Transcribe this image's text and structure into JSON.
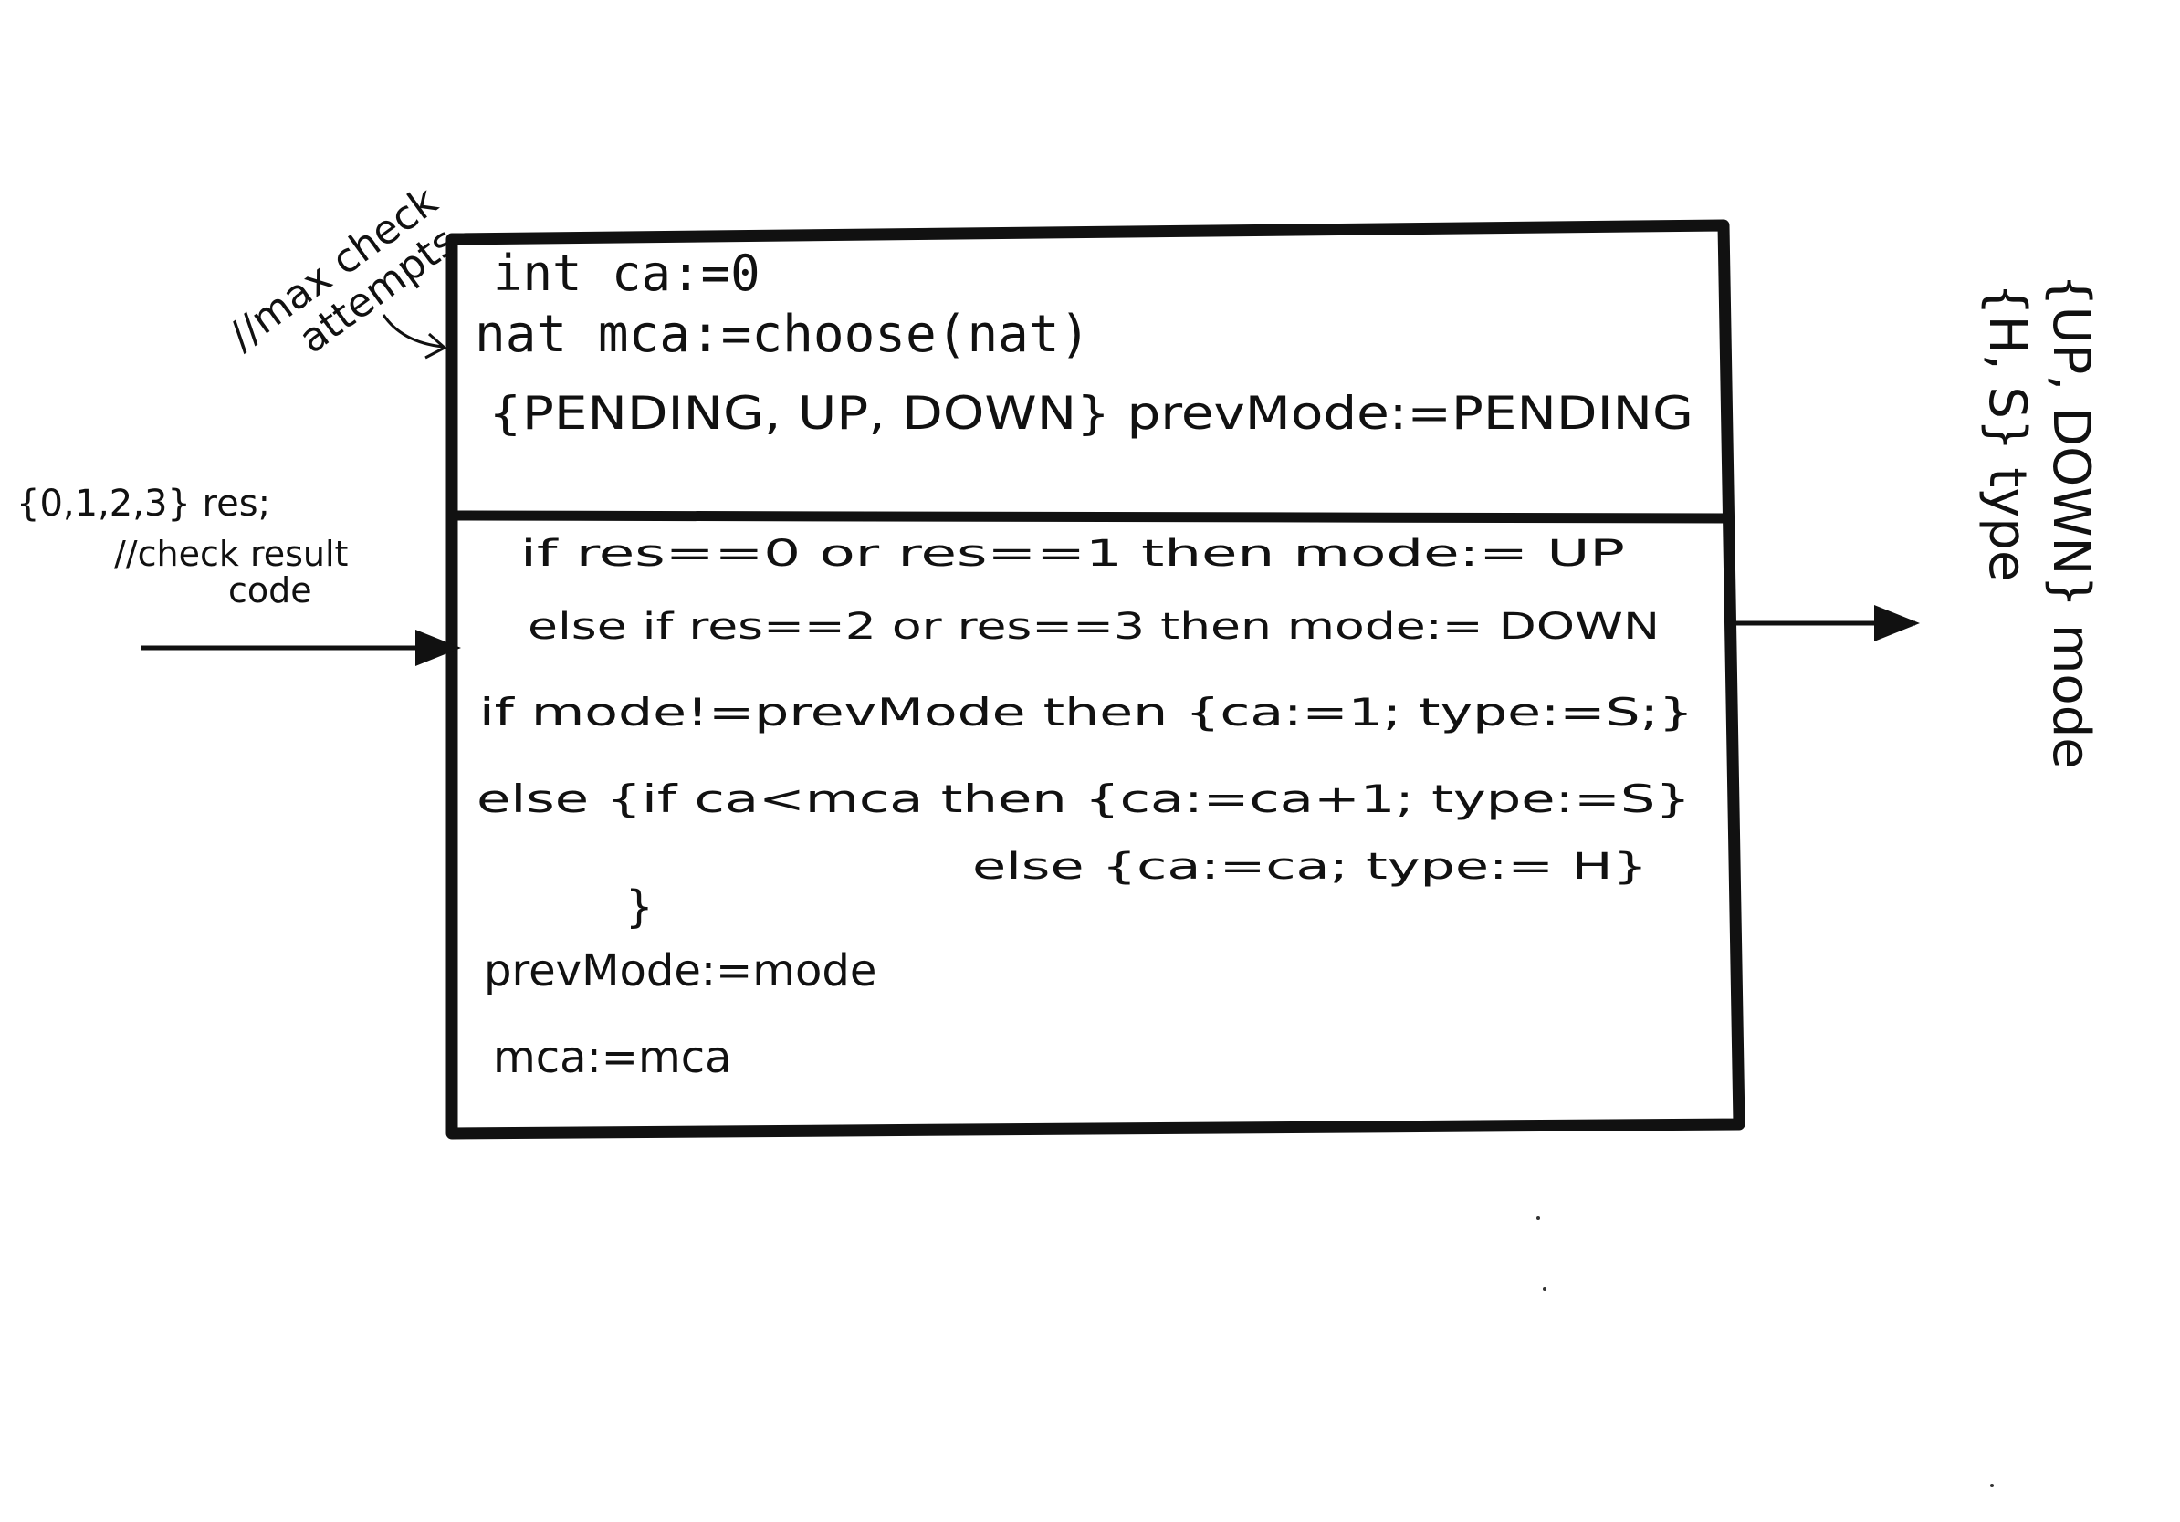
{
  "annotation_max_check": {
    "line1": "//max check",
    "line2": "attempts"
  },
  "state_block": {
    "line1": "int ca:=0",
    "line2": "nat mca:=choose(nat)",
    "line3": "{PENDING, UP, DOWN} prevMode:=PENDING"
  },
  "input": {
    "line1": "{0,1,2,3} res;",
    "line2": "//check result",
    "line3": "code"
  },
  "logic_block": {
    "line1": "if res==0 or res==1 then mode:= UP",
    "line2": "else if res==2 or res==3 then mode:= DOWN",
    "line3": "if mode!=prevMode then {ca:=1; type:=S;}",
    "line4a": "else {if ca<mca then {ca:=ca+1; type:=S}",
    "line4b": "else {ca:=ca; type:= H}",
    "line4c": "}",
    "line5": "prevMode:=mode",
    "line6": "mca:=mca"
  },
  "outputs": {
    "mode": "{UP, DOWN} mode",
    "type": "{H, S} type"
  },
  "colors": {
    "ink": "#111111",
    "paper": "#ffffff"
  }
}
